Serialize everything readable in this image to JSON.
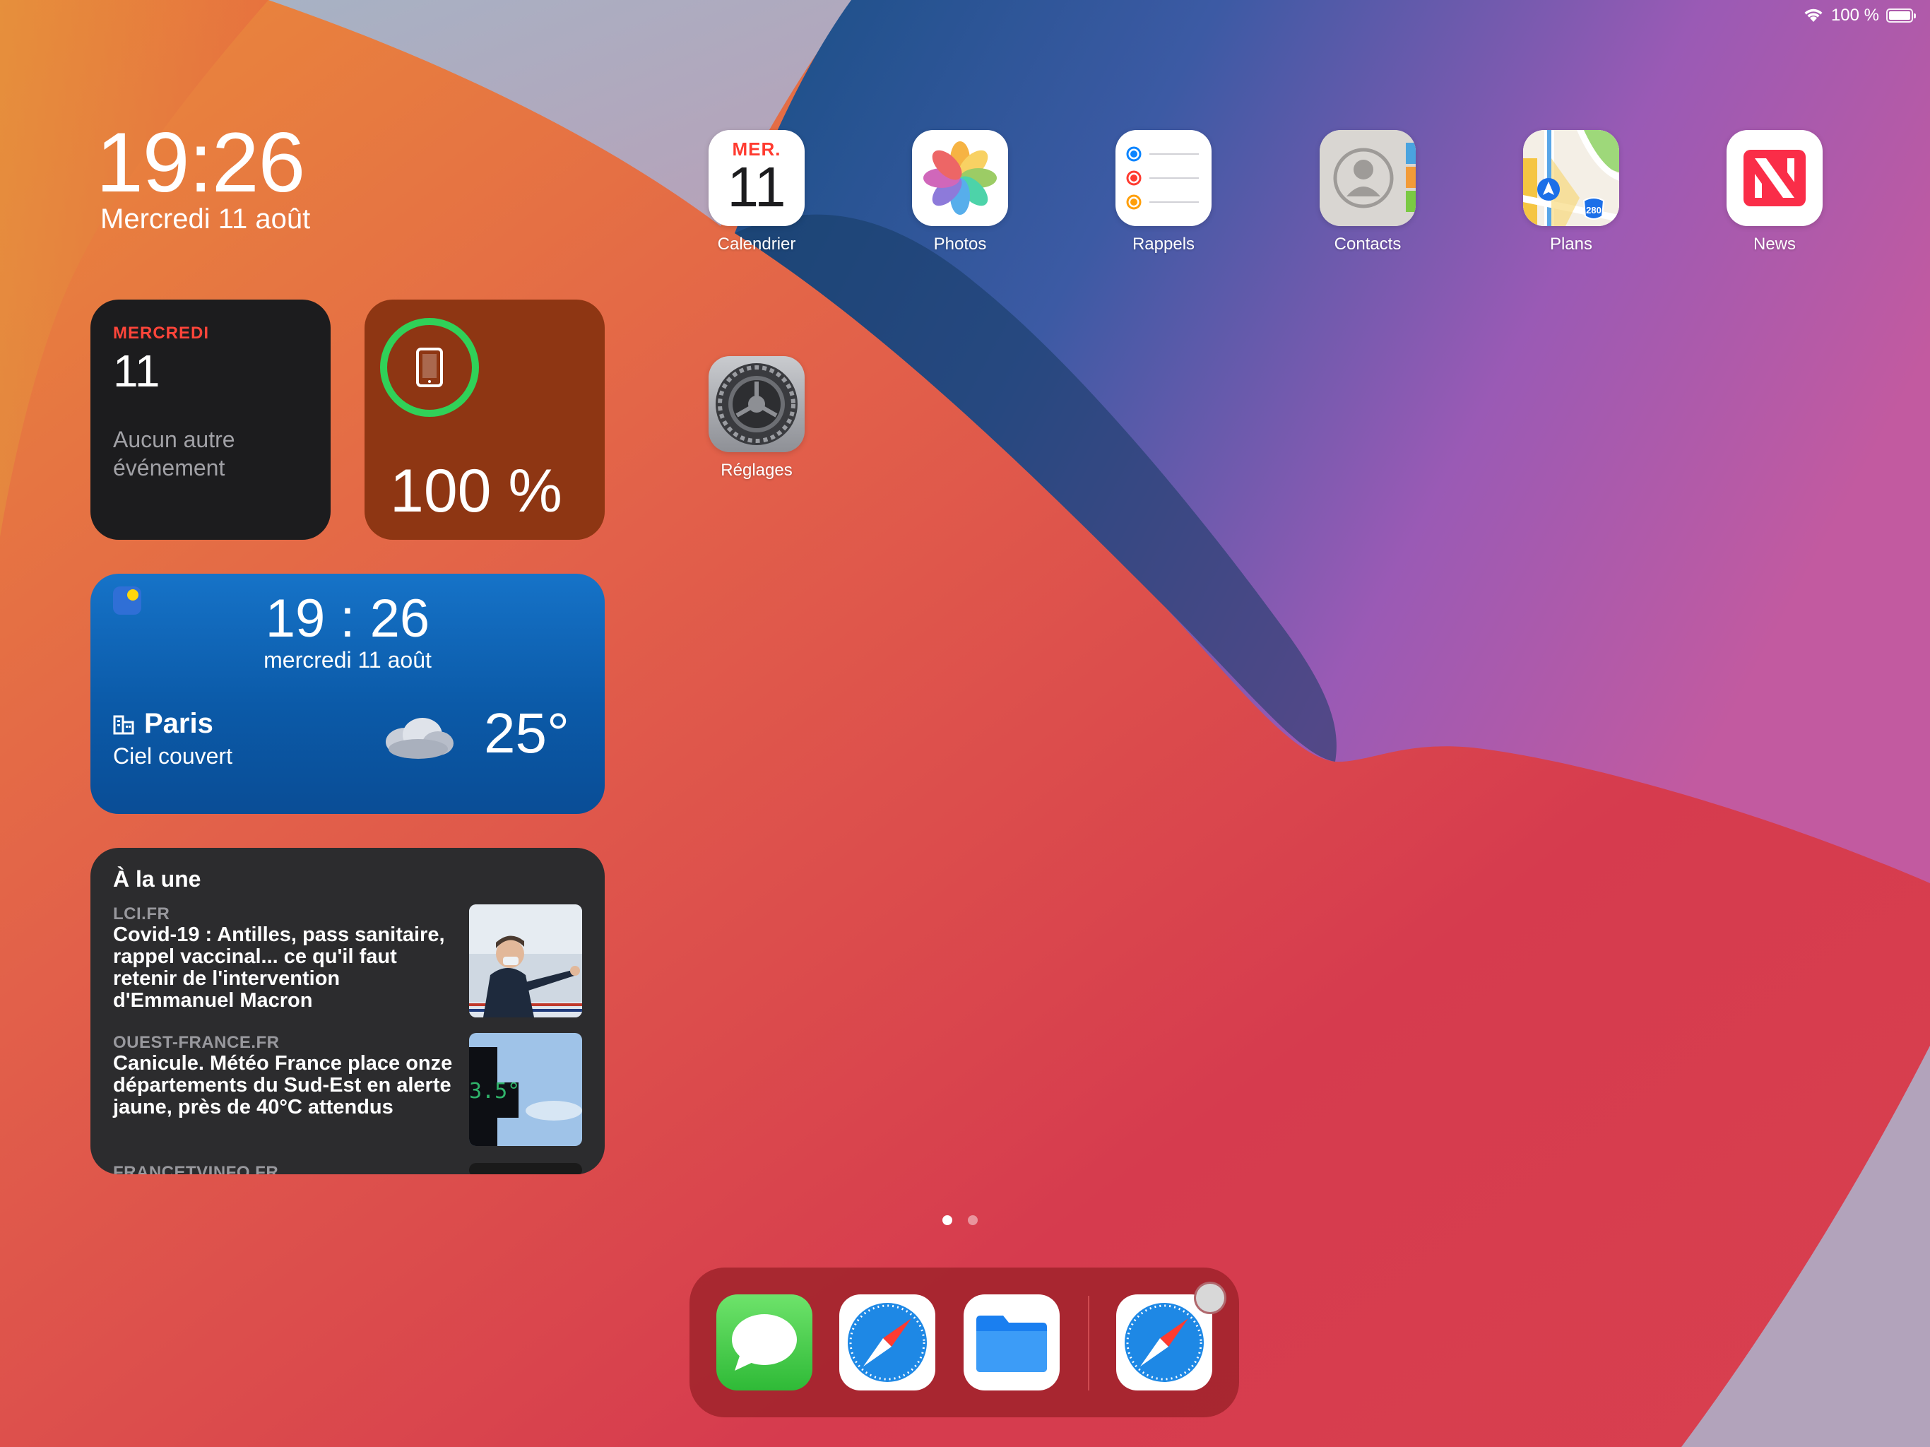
{
  "status": {
    "battery": "100 %"
  },
  "today": {
    "time": "19:26",
    "date": "Mercredi 11 août"
  },
  "calendar_widget": {
    "day": "MERCREDI",
    "number": "11",
    "message": "Aucun autre événement"
  },
  "battery_widget": {
    "percent": "100 %",
    "ring_color": "#30d158"
  },
  "weather_widget": {
    "time": "19 : 26",
    "date": "mercredi 11 août",
    "city": "Paris",
    "condition": "Ciel couvert",
    "temperature": "25°"
  },
  "news_widget": {
    "heading": "À la une",
    "items": [
      {
        "source": "LCI.FR",
        "title": "Covid-19 : Antilles, pass sanitaire, rappel vaccinal... ce qu'il faut retenir de l'intervention d'Emmanuel Macron"
      },
      {
        "source": "OUEST-FRANCE.FR",
        "title": "Canicule. Météo France place onze départements du Sud-Est en alerte jaune, près de 40°C attendus"
      },
      {
        "source": "FRANCETVINFO.FR",
        "title": ""
      }
    ]
  },
  "apps": [
    {
      "label": "Calendrier",
      "icon": "calendar-icon",
      "month": "MER.",
      "day": "11"
    },
    {
      "label": "Photos",
      "icon": "photos-icon"
    },
    {
      "label": "Rappels",
      "icon": "reminders-icon"
    },
    {
      "label": "Contacts",
      "icon": "contacts-icon"
    },
    {
      "label": "Plans",
      "icon": "maps-icon",
      "shield": "280"
    },
    {
      "label": "News",
      "icon": "news-icon"
    },
    {
      "label": "Réglages",
      "icon": "settings-icon"
    }
  ],
  "page_indicator": {
    "pages": 2,
    "current": 1
  },
  "dock": [
    {
      "icon": "messages-icon"
    },
    {
      "icon": "safari-icon"
    },
    {
      "icon": "files-icon"
    },
    {
      "icon": "safari-icon",
      "recent": true
    }
  ]
}
